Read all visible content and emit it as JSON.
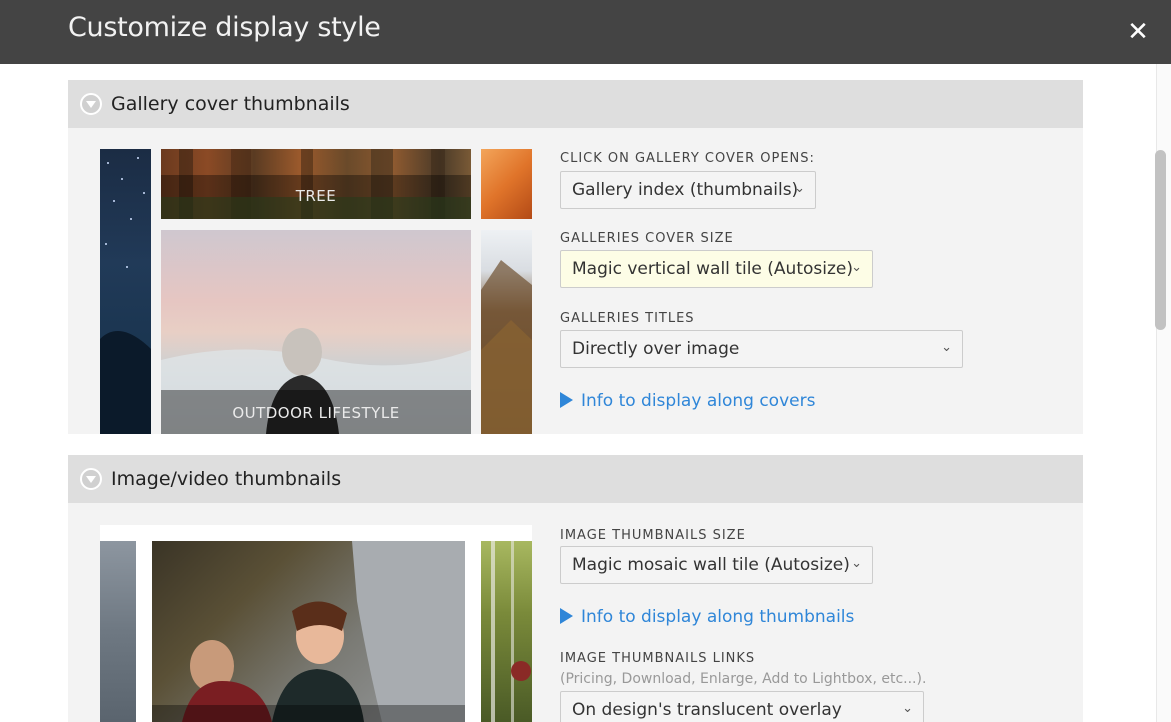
{
  "dialog": {
    "title": "Customize display style",
    "close_glyph": "✕"
  },
  "sections": [
    {
      "title": "Gallery cover thumbnails",
      "preview_labels": [
        "TREE",
        "OUTDOOR LIFESTYLE"
      ],
      "fields": [
        {
          "label": "CLICK ON GALLERY COVER OPENS:",
          "value": "Gallery index (thumbnails)"
        },
        {
          "label": "GALLERIES COVER SIZE",
          "value": "Magic vertical wall tile (Autosize)"
        },
        {
          "label": "GALLERIES TITLES",
          "value": "Directly over image"
        }
      ],
      "info_link": "Info to display along covers"
    },
    {
      "title": "Image/video thumbnails",
      "fields": [
        {
          "label": "IMAGE THUMBNAILS SIZE",
          "value": "Magic mosaic wall tile (Autosize)"
        },
        {
          "label": "IMAGE THUMBNAILS LINKS",
          "sublabel": "(Pricing, Download, Enlarge, Add to Lightbox, etc...).",
          "value": "On design's translucent overlay"
        }
      ],
      "info_link": "Info to display along thumbnails"
    }
  ],
  "icons": {
    "section_toggle": "chevron-down-circle-icon",
    "select_arrow": "chevron-down-icon",
    "info_arrow": "triangle-right-icon"
  }
}
